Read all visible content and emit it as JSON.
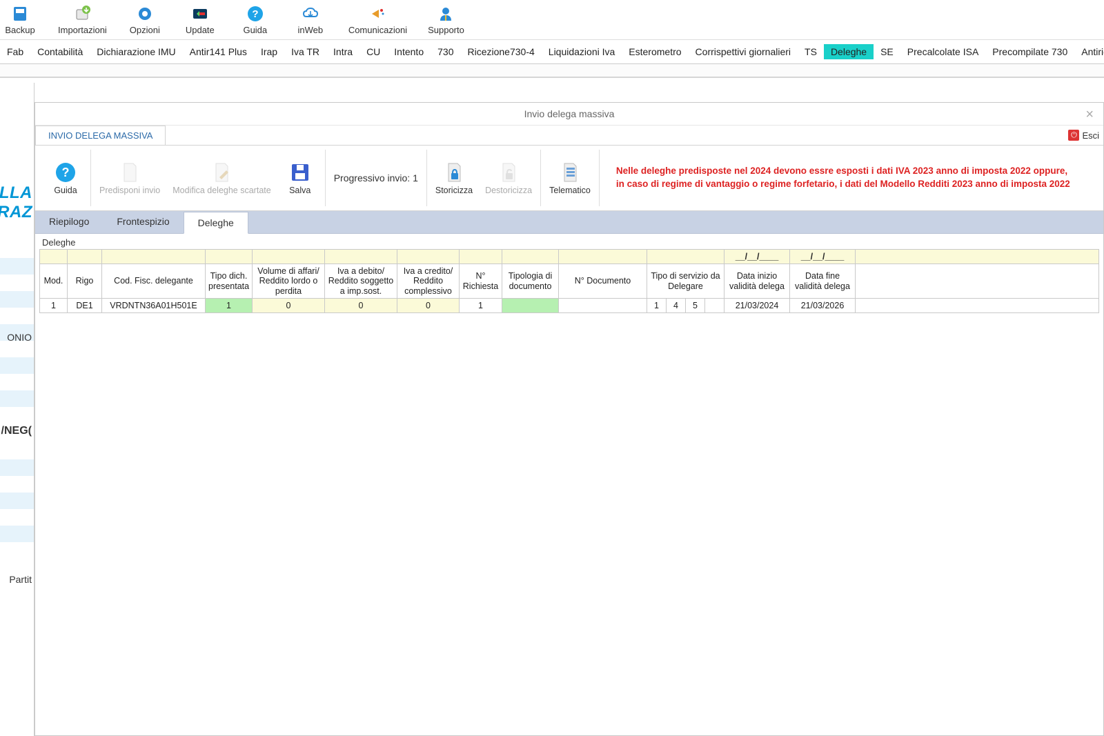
{
  "top_toolbar": [
    {
      "label": "Backup"
    },
    {
      "label": "Importazioni"
    },
    {
      "label": "Opzioni"
    },
    {
      "label": "Update"
    },
    {
      "label": "Guida"
    },
    {
      "label": "inWeb"
    },
    {
      "label": "Comunicazioni"
    },
    {
      "label": "Supporto"
    }
  ],
  "menu": [
    {
      "label": "Fab"
    },
    {
      "label": "Contabilità"
    },
    {
      "label": "Dichiarazione IMU"
    },
    {
      "label": "Antir141 Plus"
    },
    {
      "label": "Irap"
    },
    {
      "label": "Iva TR"
    },
    {
      "label": "Intra"
    },
    {
      "label": "CU"
    },
    {
      "label": "Intento"
    },
    {
      "label": "730"
    },
    {
      "label": "Ricezione730-4"
    },
    {
      "label": "Liquidazioni Iva"
    },
    {
      "label": "Esterometro"
    },
    {
      "label": "Corrispettivi giornalieri"
    },
    {
      "label": "TS"
    },
    {
      "label": "Deleghe",
      "active": true
    },
    {
      "label": "SE"
    },
    {
      "label": "Precalcolate ISA"
    },
    {
      "label": "Precompilate 730"
    },
    {
      "label": "Antiriciclag"
    }
  ],
  "left_fragments": {
    "f1": "ELLA",
    "f2": "RAZ",
    "row1": "ONIO",
    "row2": "/NEG(",
    "row3": "Partit"
  },
  "modal": {
    "title": "Invio delega massiva",
    "tab_title": "INVIO DELEGA MASSIVA",
    "esci": "Esci",
    "ribbon": {
      "guida": "Guida",
      "predisponi": "Predisponi invio",
      "modifica": "Modifica deleghe scartate",
      "salva": "Salva",
      "progressivo": "Progressivo invio: 1",
      "storicizza": "Storicizza",
      "destoricizza": "Destoricizza",
      "telematico": "Telematico",
      "warn_line1": "Nelle deleghe predisposte nel 2024 devono essre esposti i dati IVA 2023 anno di imposta 2022 oppure,",
      "warn_line2": "in caso di regime di vantaggio o regime forfetario, i dati del Modello Redditi 2023 anno di imposta 2022"
    },
    "inner_tabs": {
      "riepilogo": "Riepilogo",
      "frontespizio": "Frontespizio",
      "deleghe": "Deleghe"
    },
    "group_label": "Deleghe",
    "grid": {
      "top_date": "__/__/____",
      "headers": {
        "mod": "Mod.",
        "rigo": "Rigo",
        "cod_fisc": "Cod. Fisc. delegante",
        "tipo_dich": "Tipo dich. presentata",
        "volume": "Volume di affari/ Reddito lordo o perdita",
        "iva_debito": "Iva a debito/ Reddito soggetto a imp.sost.",
        "iva_credito": "Iva a credito/ Reddito complessivo",
        "n_richiesta": "N° Richiesta",
        "tipologia": "Tipologia di documento",
        "n_documento": "N° Documento",
        "tipo_servizio": "Tipo di servizio da Delegare",
        "data_inizio": "Data inizio validità delega",
        "data_fine": "Data fine validità delega"
      },
      "row": {
        "mod": "1",
        "rigo": "DE1",
        "cod_fisc": "VRDNTN36A01H501E",
        "tipo_dich": "1",
        "volume": "0",
        "iva_debito": "0",
        "iva_credito": "0",
        "n_richiesta": "1",
        "tipologia": "",
        "n_documento": "",
        "ts1": "1",
        "ts2": "4",
        "ts3": "5",
        "ts4": "",
        "data_inizio": "21/03/2024",
        "data_fine": "21/03/2026"
      }
    }
  }
}
